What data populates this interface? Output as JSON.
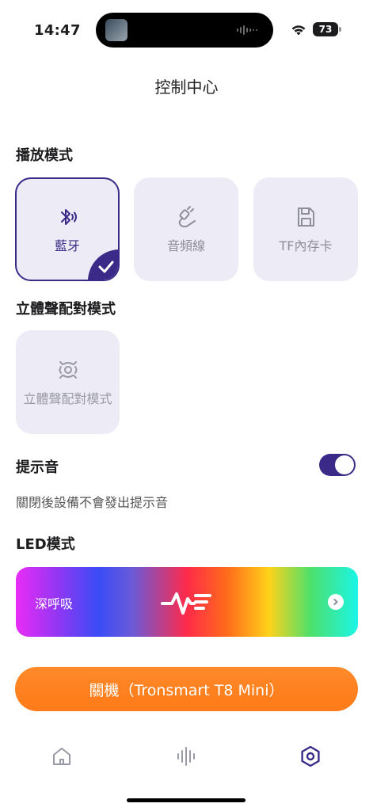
{
  "status_bar": {
    "time": "14:47",
    "battery": "73"
  },
  "page": {
    "title": "控制中心"
  },
  "playback_mode": {
    "section_title": "播放模式",
    "options": [
      {
        "label": "藍牙",
        "icon": "bluetooth-audio-icon",
        "selected": true
      },
      {
        "label": "音頻線",
        "icon": "aux-cable-icon",
        "selected": false
      },
      {
        "label": "TF內存卡",
        "icon": "sd-card-icon",
        "selected": false
      }
    ]
  },
  "stereo_pairing": {
    "section_title": "立體聲配對模式",
    "card_label": "立體聲配對模式",
    "icon": "stereo-pair-icon"
  },
  "prompt_tone": {
    "title": "提示音",
    "description": "關閉後設備不會發出提示音",
    "enabled": true
  },
  "led_mode": {
    "section_title": "LED模式",
    "current_mode": "深呼吸"
  },
  "power": {
    "label": "關機（Tronsmart T8 Mini）"
  },
  "tabbar": {
    "items": [
      {
        "icon": "home-icon",
        "active": false
      },
      {
        "icon": "equalizer-icon",
        "active": false
      },
      {
        "icon": "settings-hexagon-icon",
        "active": true
      }
    ]
  },
  "colors": {
    "accent": "#3b2a87",
    "card_bg": "#ecebf6",
    "power_orange": "#ff7a18"
  }
}
